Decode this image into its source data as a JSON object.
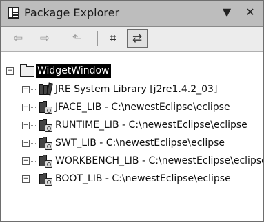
{
  "view": {
    "title": "Package Explorer",
    "menu_glyph": "▼",
    "close_glyph": "✕"
  },
  "toolbar": {
    "back_glyph": "⇦",
    "forward_glyph": "⇨",
    "up_glyph": "⬑",
    "collapse_glyph": "⌗",
    "link_glyph": "⇄"
  },
  "tree": {
    "project": {
      "label": "WidgetWindow",
      "expander": "−"
    },
    "children": [
      {
        "label": "JRE System Library [j2re1.4.2_03]",
        "expander": "+"
      },
      {
        "label": "JFACE_LIB - C:\\newestEclipse\\eclipse",
        "expander": "+"
      },
      {
        "label": "RUNTIME_LIB - C:\\newestEclipse\\eclipse",
        "expander": "+"
      },
      {
        "label": "SWT_LIB - C:\\newestEclipse\\eclipse",
        "expander": "+"
      },
      {
        "label": "WORKBENCH_LIB - C:\\newestEclipse\\eclipse",
        "expander": "+"
      },
      {
        "label": "BOOT_LIB - C:\\newestEclipse\\eclipse",
        "expander": "+"
      }
    ]
  }
}
